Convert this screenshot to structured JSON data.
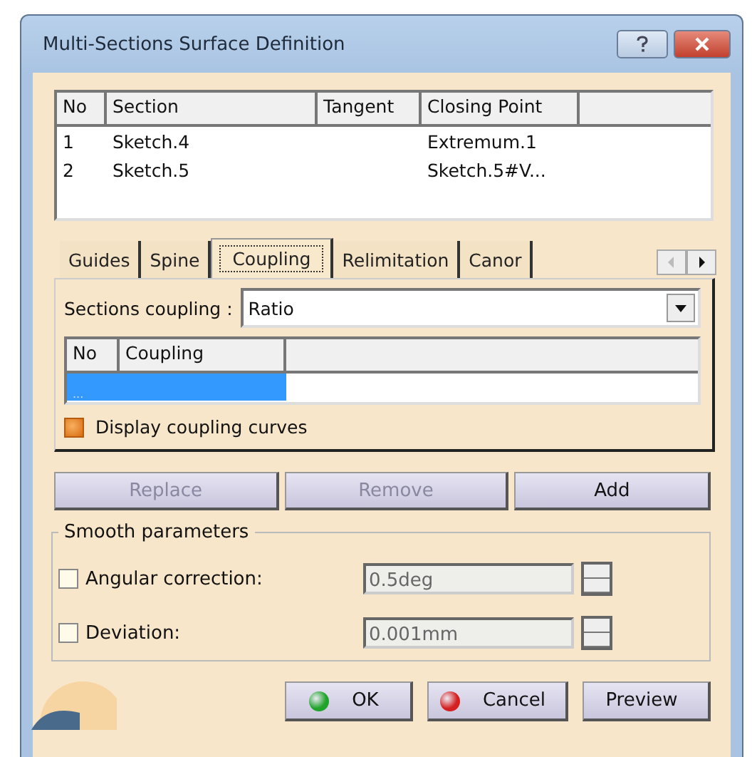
{
  "window": {
    "title": "Multi-Sections Surface Definition"
  },
  "sections_table": {
    "columns": [
      "No",
      "Section",
      "Tangent",
      "Closing Point"
    ],
    "rows": [
      {
        "cells": [
          "1",
          "Sketch.4",
          "",
          "Extremum.1"
        ],
        "selected": false
      },
      {
        "cells": [
          "2",
          "Sketch.5",
          "",
          "Sketch.5#V..."
        ],
        "selected": false
      }
    ]
  },
  "tabs": [
    {
      "label": "Guides",
      "selected": false
    },
    {
      "label": "Spine",
      "selected": false
    },
    {
      "label": "Coupling",
      "selected": true
    },
    {
      "label": "Relimitation",
      "selected": false
    },
    {
      "label": "Canor",
      "selected": false
    }
  ],
  "sections_coupling": {
    "label": "Sections coupling :",
    "value": "Ratio"
  },
  "coupling_table": {
    "columns": [
      "No",
      "Coupling"
    ],
    "rows": [
      {
        "cells": [
          "...",
          ""
        ],
        "selected": true
      }
    ]
  },
  "display_coupling_curves": {
    "label": "Display coupling curves",
    "checked": true
  },
  "list_buttons": [
    {
      "label": "Replace",
      "disabled": true
    },
    {
      "label": "Remove",
      "disabled": true
    },
    {
      "label": "Add",
      "disabled": false
    }
  ],
  "smooth_parameters": {
    "title": "Smooth parameters",
    "rows": [
      {
        "label": "Angular correction:",
        "checked": false,
        "value": "0.5deg",
        "disabled": true
      },
      {
        "label": "Deviation:",
        "checked": false,
        "value": "0.001mm",
        "disabled": true
      }
    ]
  },
  "dialog_buttons": [
    {
      "label": "OK",
      "kind": "ok"
    },
    {
      "label": "Cancel",
      "kind": "cancel"
    },
    {
      "label": "Preview",
      "kind": "plain"
    }
  ]
}
